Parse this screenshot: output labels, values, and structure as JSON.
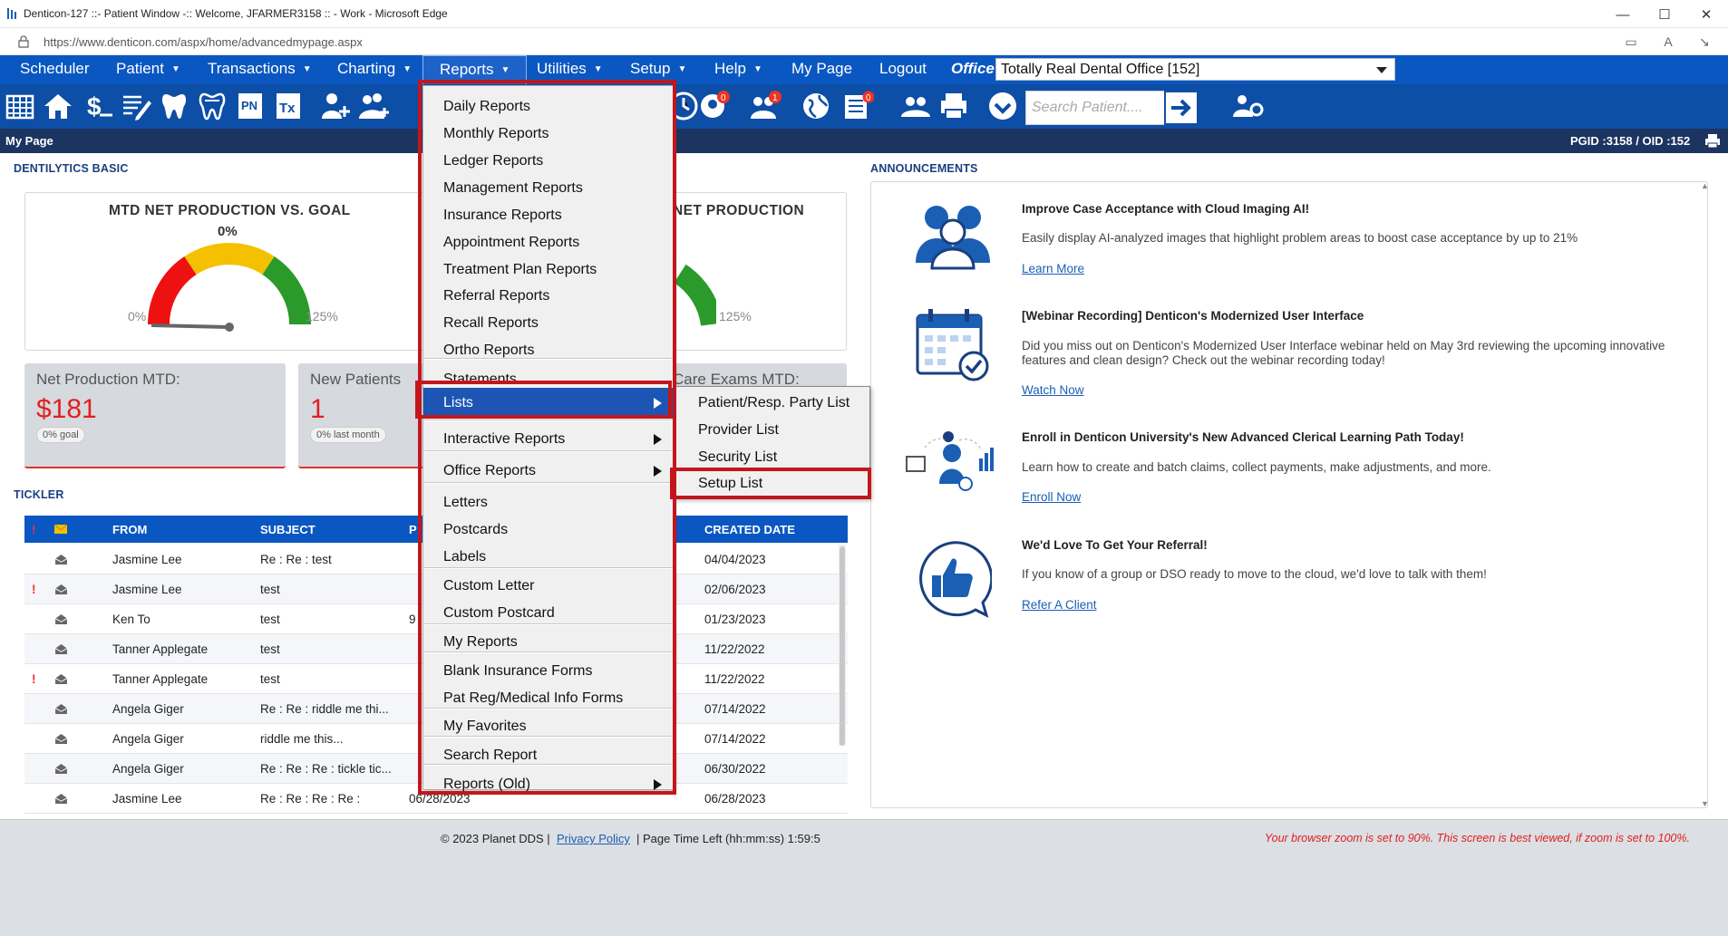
{
  "window": {
    "title": "Denticon-127 ::- Patient Window -:: Welcome, JFARMER3158 :: - Work - Microsoft Edge",
    "url": "https://www.denticon.com/aspx/home/advancedmypage.aspx"
  },
  "nav": {
    "items": [
      "Scheduler",
      "Patient",
      "Transactions",
      "Charting",
      "Reports",
      "Utilities",
      "Setup",
      "Help",
      "My Page",
      "Logout"
    ],
    "office_label": "Office",
    "office_value": "Totally Real Dental Office [152]"
  },
  "toolbar": {
    "search_placeholder": "Search Patient....",
    "badges": [
      "0",
      "1",
      "0"
    ]
  },
  "mypage_bar": {
    "title": "My Page",
    "ids": "PGID :3158  /  OID :152"
  },
  "dentilytics": {
    "section_title": "DENTILYTICS BASIC",
    "gauge1": {
      "title": "MTD NET PRODUCTION VS. GOAL",
      "percent": "0%",
      "min": "0%",
      "max": "125%"
    },
    "gauge2": {
      "title": "NET PRODUCTION",
      "max": "125%"
    },
    "stats": [
      {
        "label": "Net Production MTD:",
        "value": "$181",
        "pill": "0% goal"
      },
      {
        "label": "New Patients",
        "value": "1",
        "pill": "0% last month"
      },
      {
        "label": "Care Exams MTD:"
      }
    ]
  },
  "tickler": {
    "section_title": "TICKLER",
    "columns": [
      "FROM",
      "SUBJECT",
      "P",
      "CREATED DATE"
    ],
    "rows": [
      {
        "flag": "",
        "from": "Jasmine Lee",
        "subject": "Re : Re : test",
        "p": "",
        "date": "04/04/2023"
      },
      {
        "flag": "!",
        "from": "Jasmine Lee",
        "subject": "test",
        "p": "",
        "date": "02/06/2023"
      },
      {
        "flag": "",
        "from": "Ken To",
        "subject": "test",
        "p": "9",
        "date": "01/23/2023"
      },
      {
        "flag": "",
        "from": "Tanner Applegate",
        "subject": "test",
        "p": "",
        "date": "11/22/2022"
      },
      {
        "flag": "!",
        "from": "Tanner Applegate",
        "subject": "test",
        "p": "",
        "date": "11/22/2022"
      },
      {
        "flag": "",
        "from": "Angela Giger",
        "subject": "Re : Re : riddle me thi...",
        "p": "",
        "date": "07/14/2022"
      },
      {
        "flag": "",
        "from": "Angela Giger",
        "subject": "riddle me this...",
        "p": "",
        "date": "07/14/2022"
      },
      {
        "flag": "",
        "from": "Angela Giger",
        "subject": "Re : Re : Re : tickle tic...",
        "p": "",
        "date": "06/30/2022"
      },
      {
        "flag": "",
        "from": "Jasmine Lee",
        "subject": "Re : Re : Re : Re :",
        "p": "06/28/2023",
        "date": "06/28/2023"
      }
    ]
  },
  "announcements": {
    "section_title": "ANNOUNCEMENTS",
    "items": [
      {
        "title": "Improve Case Acceptance with Cloud Imaging AI!",
        "body": "Easily display AI-analyzed images that highlight problem areas to boost case acceptance by up to 21%",
        "link": "Learn More",
        "icon": "people-icon"
      },
      {
        "title": "[Webinar Recording] Denticon's Modernized User Interface",
        "body": "Did you miss out on Denticon's Modernized User Interface webinar held on May 3rd reviewing the upcoming innovative features and clean design? Check out the webinar recording today!",
        "link": "Watch Now",
        "icon": "calendar-icon"
      },
      {
        "title": "Enroll in Denticon University's New Advanced Clerical Learning Path Today!",
        "body": "Learn how to create and batch claims, collect payments, make adjustments, and more.",
        "link": "Enroll Now",
        "icon": "learning-icon"
      },
      {
        "title": "We'd Love To Get Your Referral!",
        "body": "If you know of a group or DSO ready to move to the cloud, we'd love to talk with them!",
        "link": "Refer A Client",
        "icon": "thumbs-up-icon"
      }
    ]
  },
  "reports_menu": {
    "items": [
      "Daily Reports",
      "Monthly Reports",
      "Ledger Reports",
      "Management Reports",
      "Insurance Reports",
      "Appointment Reports",
      "Treatment Plan Reports",
      "Referral Reports",
      "Recall Reports",
      "Ortho Reports",
      "Statements",
      "Lists",
      "Interactive Reports",
      "Office Reports",
      "Letters",
      "Postcards",
      "Labels",
      "Custom Letter",
      "Custom Postcard",
      "My Reports",
      "Blank Insurance Forms",
      "Pat Reg/Medical Info Forms",
      "My Favorites",
      "Search Report",
      "Reports (Old)"
    ]
  },
  "lists_menu": {
    "items": [
      "Patient/Resp. Party List",
      "Provider List",
      "Security List",
      "Setup List"
    ]
  },
  "footer": {
    "copyright": "© 2023 Planet DDS |",
    "privacy": "Privacy Policy",
    "time_left": "| Page Time Left (hh:mm:ss) 1:59:5",
    "zoom_warning": "Your browser zoom is set to 90%. This screen is best viewed, if zoom is set to 100%."
  },
  "colors": {
    "nav": "#0a57c2",
    "toolbar": "#0d4ea6",
    "highlight": "#c3161c",
    "accent_red": "#e02020"
  }
}
